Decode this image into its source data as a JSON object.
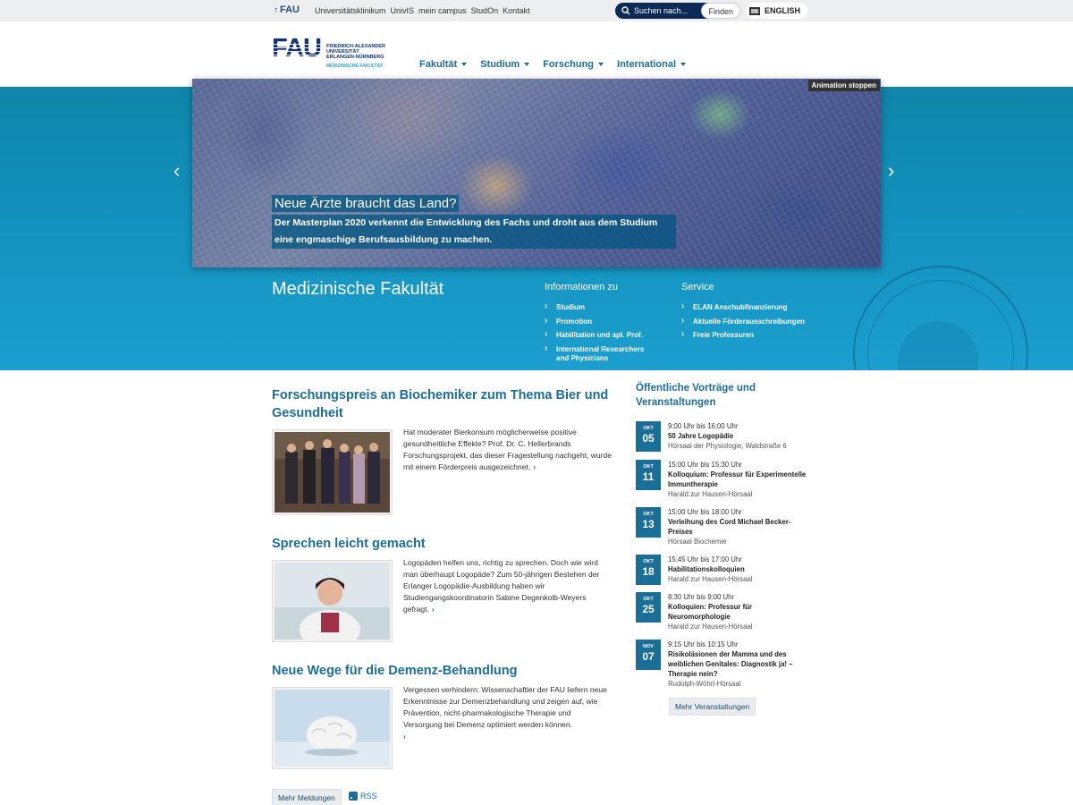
{
  "topbar": {
    "home_label": "FAU",
    "links": [
      "Universitätsklinikum",
      "UnivIS",
      "mein campus",
      "StudOn",
      "Kontakt"
    ],
    "search_placeholder": "Suchen nach...",
    "search_button": "Finden",
    "language": "ENGLISH"
  },
  "logo": {
    "mark": "FAU",
    "line1": "FRIEDRICH-ALEXANDER",
    "line2": "UNIVERSITÄT",
    "line3": "ERLANGEN-NÜRNBERG",
    "faculty": "MEDIZINISCHE FAKULTÄT"
  },
  "nav": [
    "Fakultät",
    "Studium",
    "Forschung",
    "International"
  ],
  "hero": {
    "animation_stop": "Animation stoppen",
    "title": "Neue Ärzte braucht das Land?",
    "text": "Der Masterplan 2020 verkennt die Entwicklung des Fachs und droht aus dem Studium eine engmaschige Berufsausbildung zu machen.",
    "prev_icon": "‹",
    "next_icon": "›"
  },
  "faculty_title": "Medizinische Fakultät",
  "info": {
    "heading": "Informationen zu",
    "items": [
      "Studium",
      "Promotion",
      "Habilitation und apl. Prof.",
      "International Researchers and Physicians"
    ]
  },
  "service": {
    "heading": "Service",
    "items": [
      "ELAN Anschubfinanzierung",
      "Aktuelle Förderausschreibungen",
      "Freie Professuren"
    ]
  },
  "news": [
    {
      "title": "Forschungspreis an Biochemiker zum Thema Bier und Gesundheit",
      "text": "Hat moderater Bierkonsum möglicherweise positive gesundheitliche Effekte? Prof. Dr. C. Hellerbrands Forschungsprojekt, das dieser Fragestellung nachgeht, wurde mit einem Förderpreis ausgezeichnet."
    },
    {
      "title": "Sprechen leicht gemacht",
      "text": "Logopäden helfen uns, richtig zu sprechen. Doch wie wird man überhaupt Logopäde? Zum 50-jährigen Bestehen der Erlanger Logopädie-Ausbildung haben wir Studiengangskoordinatorin Sabine Degenkolb-Weyers gefragt."
    },
    {
      "title": "Neue Wege für die Demenz-Behandlung",
      "text": "Vergessen verhindern: Wissenschaftler der FAU liefern neue Erkenntnisse zur Demenzbehandlung und zeigen auf, wie Prävention, nicht-pharmakologische Therapie und Versorgung bei Demenz optimiert werden können."
    }
  ],
  "news_more": "Mehr Meldungen",
  "rss": "RSS",
  "events_heading": "Öffentliche Vorträge und Veranstaltungen",
  "events": [
    {
      "month": "OKT",
      "day": "05",
      "time": "9:00 Uhr bis 16:00 Uhr",
      "title": "50 Jahre Logopädie",
      "location": "Hörsaal der Physiologie, Waldstraße 6"
    },
    {
      "month": "OKT",
      "day": "11",
      "time": "15:00 Uhr bis 15:30 Uhr",
      "title": "Kolloquium: Professur für Experimentelle Immuntherapie",
      "location": "Harald zur Hausen-Hörsaal"
    },
    {
      "month": "OKT",
      "day": "13",
      "time": "15:00 Uhr bis 18:00 Uhr",
      "title": "Verleihung des Cord Michael Becker-Preises",
      "location": "Hörsaal Biochemie"
    },
    {
      "month": "OKT",
      "day": "18",
      "time": "15:45 Uhr bis 17:00 Uhr",
      "title": "Habilitationskolloquien",
      "location": "Harald zur Hausen-Hörsaal"
    },
    {
      "month": "OKT",
      "day": "25",
      "time": "8:30 Uhr bis 9:00 Uhr",
      "title": "Kolloquien: Professur für Neuromorphologie",
      "location": "Harald zur Hausen-Hörsaal"
    },
    {
      "month": "NOV",
      "day": "07",
      "time": "9:15 Uhr bis 10:15 Uhr",
      "title": "Risikoläsionen der Mamma und des weiblichen Genitales: Diagnostik ja! – Therapie nein?",
      "location": "Rudolph-Wöhrl-Hörsaal"
    }
  ],
  "events_more": "Mehr Veranstaltungen",
  "colors": {
    "accent": "#1a6f98",
    "hero": "#1291bd",
    "navy": "#11317a"
  }
}
